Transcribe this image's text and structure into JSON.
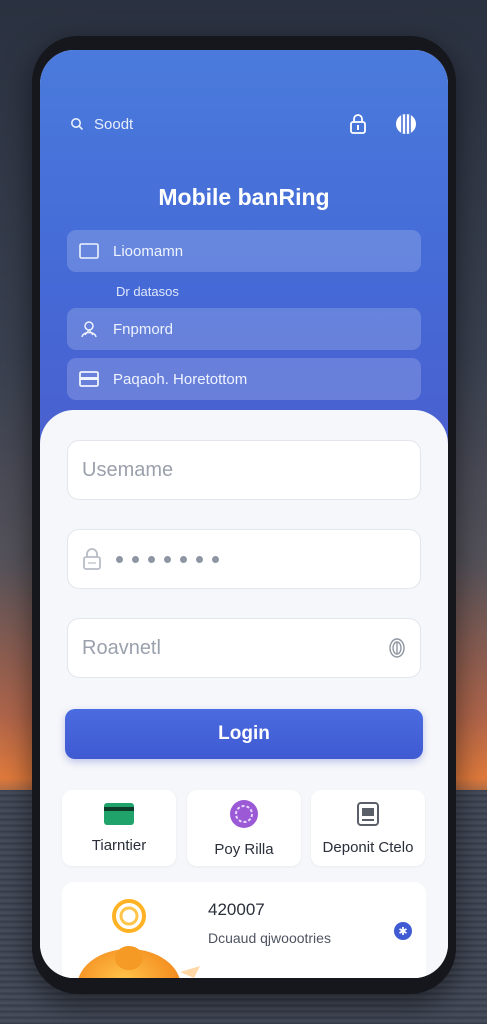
{
  "header": {
    "search_label": "Soodt"
  },
  "hero": {
    "title": "Mobile banRing",
    "rows": [
      {
        "label": "Lioomamn"
      },
      {
        "label": "Fnpmord"
      },
      {
        "label": "Paqaoh. Horetottom"
      }
    ],
    "caption": "Dr datasos"
  },
  "form": {
    "username_placeholder": "Usemame",
    "password_mask": "•••••••",
    "third_field_placeholder": "Roavnetl",
    "login_label": "Login"
  },
  "quick_actions": [
    {
      "label": "Tiarntier",
      "icon": "card-icon"
    },
    {
      "label": "Poy Rilla",
      "icon": "coin-icon"
    },
    {
      "label": "Deponit Ctelo",
      "icon": "atm-icon"
    }
  ],
  "balance": {
    "amount": "420007",
    "subtitle": "Dcuaud qjwoootries"
  },
  "colors": {
    "accent": "#4569d6",
    "button": "#3f5ad2",
    "coin": "#9b59d6",
    "card": "#1fa36a"
  }
}
